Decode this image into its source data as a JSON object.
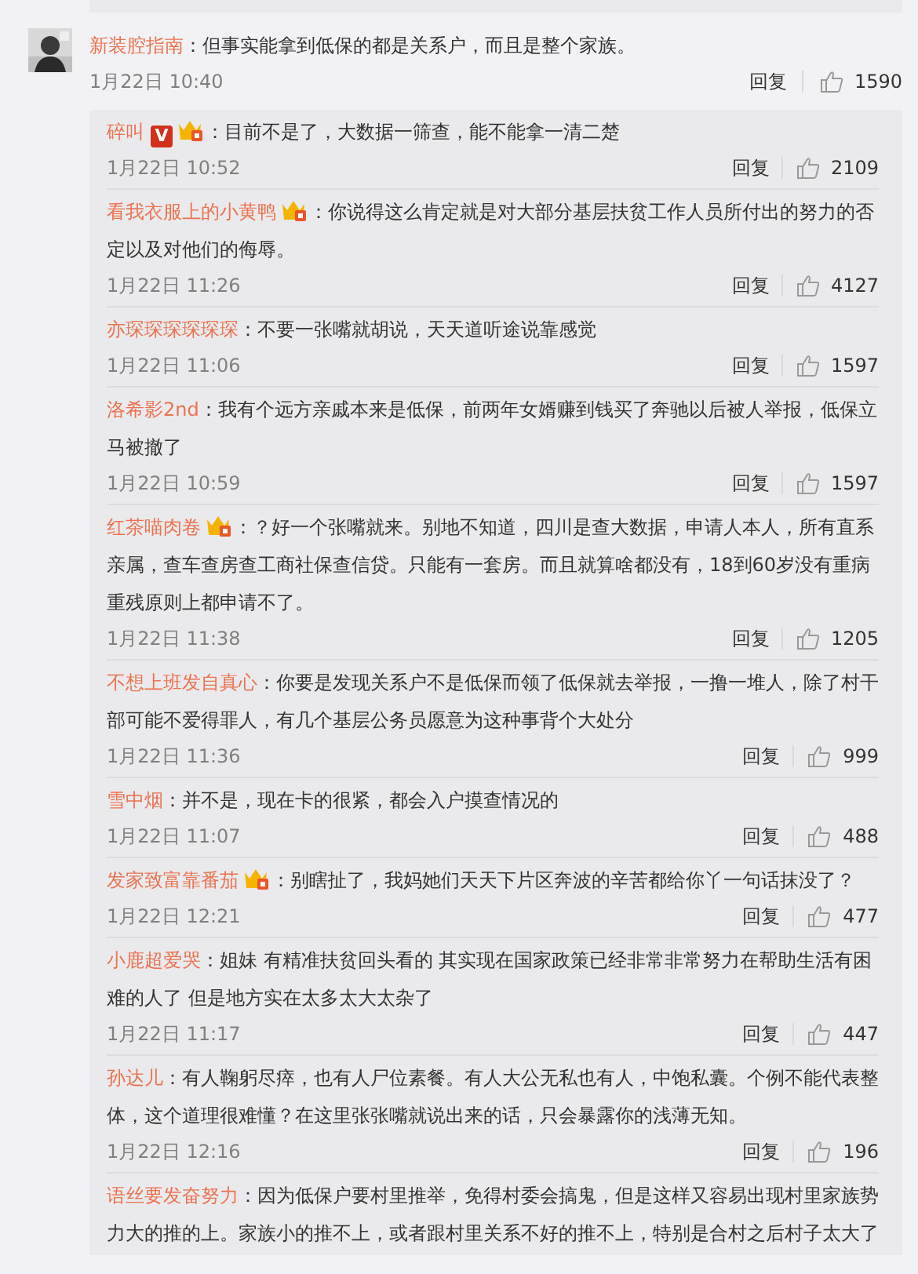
{
  "comment": {
    "author": "新装腔指南",
    "text": "：但事实能拿到低保的都是关系户，而且是整个家族。",
    "time": "1月22日 10:40",
    "reply_label": "回复",
    "likes": "1590"
  },
  "replies": [
    {
      "author": "碎叫",
      "badges": [
        {
          "kind": "vip",
          "text": "V"
        },
        {
          "kind": "crown"
        }
      ],
      "text": "：目前不是了，大数据一筛查，能不能拿一清二楚",
      "time": "1月22日 10:52",
      "reply_label": "回复",
      "likes": "2109"
    },
    {
      "author": "看我衣服上的小黄鸭",
      "badges": [
        {
          "kind": "crown"
        }
      ],
      "text": "：你说得这么肯定就是对大部分基层扶贫工作人员所付出的努力的否定以及对他们的侮辱。",
      "time": "1月22日 11:26",
      "reply_label": "回复",
      "likes": "4127"
    },
    {
      "author": "亦琛琛琛琛琛琛",
      "text": "：不要一张嘴就胡说，天天道听途说靠感觉",
      "time": "1月22日 11:06",
      "reply_label": "回复",
      "likes": "1597"
    },
    {
      "author": "洛希影2nd",
      "text": "：我有个远方亲戚本来是低保，前两年女婿赚到钱买了奔驰以后被人举报，低保立马被撤了",
      "time": "1月22日 10:59",
      "reply_label": "回复",
      "likes": "1597"
    },
    {
      "author": "红茶喵肉卷",
      "badges": [
        {
          "kind": "crown"
        }
      ],
      "text": "：？好一个张嘴就来。别地不知道，四川是查大数据，申请人本人，所有直系亲属，查车查房查工商社保查信贷。只能有一套房。而且就算啥都没有，18到60岁没有重病重残原则上都申请不了。",
      "time": "1月22日 11:38",
      "reply_label": "回复",
      "likes": "1205"
    },
    {
      "author": "不想上班发自真心",
      "text": "：你要是发现关系户不是低保而领了低保就去举报，一撸一堆人，除了村干部可能不爱得罪人，有几个基层公务员愿意为这种事背个大处分",
      "time": "1月22日 11:36",
      "reply_label": "回复",
      "likes": "999"
    },
    {
      "author": "雪中烟",
      "text": "：并不是，现在卡的很紧，都会入户摸查情况的",
      "time": "1月22日 11:07",
      "reply_label": "回复",
      "likes": "488"
    },
    {
      "author": "发家致富靠番茄",
      "badges": [
        {
          "kind": "crown"
        }
      ],
      "text": "：别瞎扯了，我妈她们天天下片区奔波的辛苦都给你丫一句话抹没了？",
      "time": "1月22日 12:21",
      "reply_label": "回复",
      "likes": "477"
    },
    {
      "author": "小鹿超爱哭",
      "text": "：姐妹 有精准扶贫回头看的 其实现在国家政策已经非常非常努力在帮助生活有困难的人了 但是地方实在太多太大太杂了",
      "time": "1月22日 11:17",
      "reply_label": "回复",
      "likes": "447"
    },
    {
      "author": "孙达儿",
      "text": "：有人鞠躬尽瘁，也有人尸位素餐。有人大公无私也有人，中饱私囊。个例不能代表整体，这个道理很难懂？在这里张张嘴就说出来的话，只会暴露你的浅薄无知。",
      "time": "1月22日 12:16",
      "reply_label": "回复",
      "likes": "196"
    },
    {
      "author": "语丝要发奋努力",
      "text": "：因为低保户要村里推举，免得村委会搞鬼，但是这样又容易出现村里家族势力大的推的上。家族小的推不上，或者跟村里关系不好的推不上，特别是合村之后村子太大了"
    }
  ]
}
